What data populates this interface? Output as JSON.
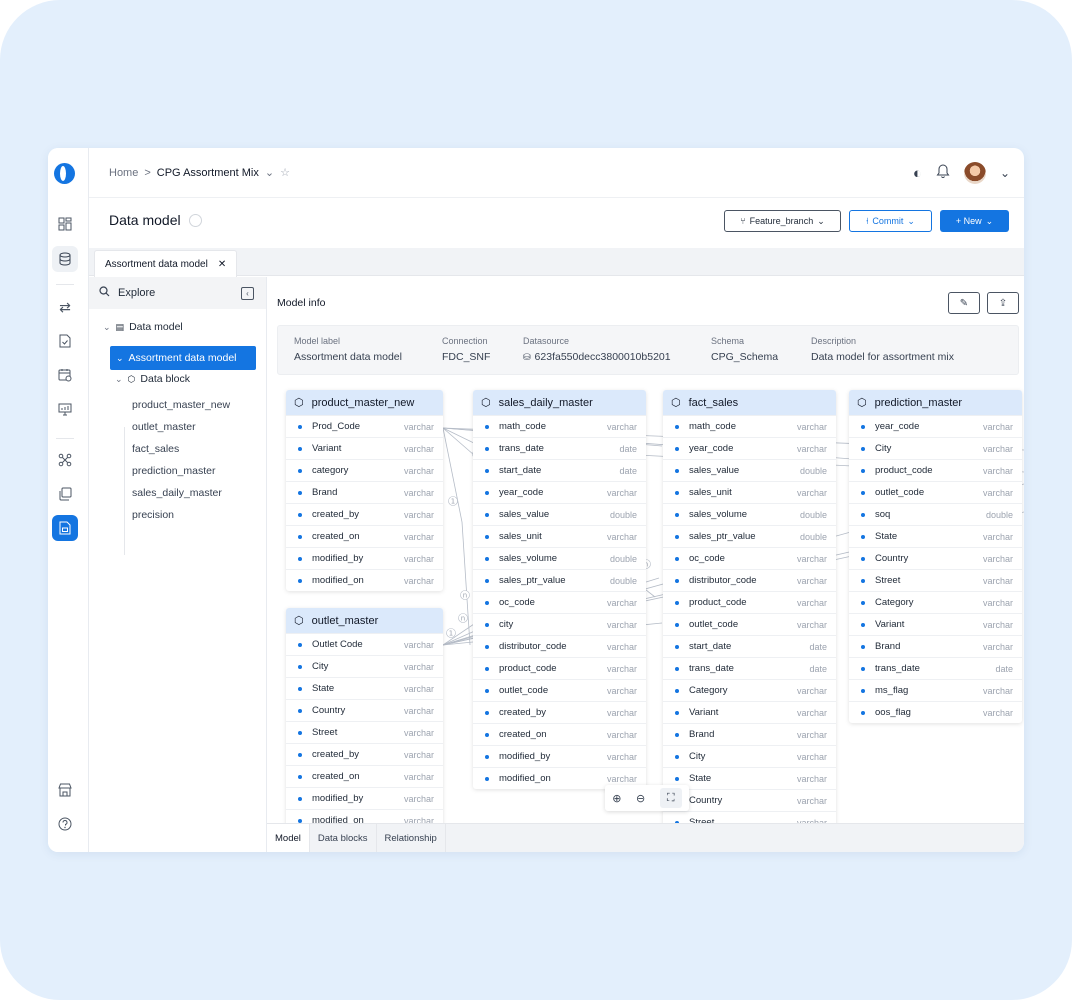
{
  "breadcrumb": {
    "home": "Home",
    "sep": ">",
    "current": "CPG Assortment Mix"
  },
  "page": {
    "title": "Data model"
  },
  "buttons": {
    "feature_branch": "Feature_branch",
    "commit": "Commit",
    "new": "+ New"
  },
  "doc_tab": {
    "label": "Assortment data model",
    "close": "✕"
  },
  "explore": {
    "title": "Explore",
    "tree": {
      "root": "Data model",
      "selected": "Assortment data model",
      "group": "Data block",
      "leaves": [
        "product_master_new",
        "outlet_master",
        "fact_sales",
        "prediction_master",
        "sales_daily_master",
        "precision"
      ]
    }
  },
  "model_info": {
    "title": "Model info",
    "fields": [
      {
        "key": "Model label",
        "value": "Assortment data model"
      },
      {
        "key": "Connection",
        "value": "FDC_SNF"
      },
      {
        "key": "Datasource",
        "value": "623fa550decc3800010b5201"
      },
      {
        "key": "Schema",
        "value": "CPG_Schema"
      },
      {
        "key": "Description",
        "value": "Data model for assortment mix"
      }
    ]
  },
  "tables": {
    "product_master_new": {
      "name": "product_master_new",
      "rows": [
        {
          "n": "Prod_Code",
          "t": "varchar"
        },
        {
          "n": "Variant",
          "t": "varchar"
        },
        {
          "n": "category",
          "t": "varchar"
        },
        {
          "n": "Brand",
          "t": "varchar"
        },
        {
          "n": "created_by",
          "t": "varchar"
        },
        {
          "n": "created_on",
          "t": "varchar"
        },
        {
          "n": "modified_by",
          "t": "varchar"
        },
        {
          "n": "modified_on",
          "t": "varchar"
        }
      ]
    },
    "outlet_master": {
      "name": "outlet_master",
      "rows": [
        {
          "n": "Outlet Code",
          "t": "varchar"
        },
        {
          "n": "City",
          "t": "varchar"
        },
        {
          "n": "State",
          "t": "varchar"
        },
        {
          "n": "Country",
          "t": "varchar"
        },
        {
          "n": "Street",
          "t": "varchar"
        },
        {
          "n": "created_by",
          "t": "varchar"
        },
        {
          "n": "created_on",
          "t": "varchar"
        },
        {
          "n": "modified_by",
          "t": "varchar"
        },
        {
          "n": "modified_on",
          "t": "varchar"
        }
      ]
    },
    "sales_daily_master": {
      "name": "sales_daily_master",
      "rows": [
        {
          "n": "math_code",
          "t": "varchar"
        },
        {
          "n": "trans_date",
          "t": "date"
        },
        {
          "n": "start_date",
          "t": "date"
        },
        {
          "n": "year_code",
          "t": "varchar"
        },
        {
          "n": "sales_value",
          "t": "double"
        },
        {
          "n": "sales_unit",
          "t": "varchar"
        },
        {
          "n": "sales_volume",
          "t": "double"
        },
        {
          "n": "sales_ptr_value",
          "t": "double"
        },
        {
          "n": "oc_code",
          "t": "varchar"
        },
        {
          "n": "city",
          "t": "varchar"
        },
        {
          "n": "distributor_code",
          "t": "varchar"
        },
        {
          "n": "product_code",
          "t": "varchar"
        },
        {
          "n": "outlet_code",
          "t": "varchar"
        },
        {
          "n": "created_by",
          "t": "varchar"
        },
        {
          "n": "created_on",
          "t": "varchar"
        },
        {
          "n": "modified_by",
          "t": "varchar"
        },
        {
          "n": "modified_on",
          "t": "varchar"
        }
      ]
    },
    "fact_sales": {
      "name": "fact_sales",
      "rows": [
        {
          "n": "math_code",
          "t": "varchar"
        },
        {
          "n": "year_code",
          "t": "varchar"
        },
        {
          "n": "sales_value",
          "t": "double"
        },
        {
          "n": "sales_unit",
          "t": "varchar"
        },
        {
          "n": "sales_volume",
          "t": "double"
        },
        {
          "n": "sales_ptr_value",
          "t": "double"
        },
        {
          "n": "oc_code",
          "t": "varchar"
        },
        {
          "n": "distributor_code",
          "t": "varchar"
        },
        {
          "n": "product_code",
          "t": "varchar"
        },
        {
          "n": "outlet_code",
          "t": "varchar"
        },
        {
          "n": "start_date",
          "t": "date"
        },
        {
          "n": "trans_date",
          "t": "date"
        },
        {
          "n": "Category",
          "t": "varchar"
        },
        {
          "n": "Variant",
          "t": "varchar"
        },
        {
          "n": "Brand",
          "t": "varchar"
        },
        {
          "n": "City",
          "t": "varchar"
        },
        {
          "n": "State",
          "t": "varchar"
        },
        {
          "n": "Country",
          "t": "varchar"
        },
        {
          "n": "Street",
          "t": "varchar"
        }
      ]
    },
    "prediction_master": {
      "name": "prediction_master",
      "rows": [
        {
          "n": "year_code",
          "t": "varchar"
        },
        {
          "n": "City",
          "t": "varchar"
        },
        {
          "n": "product_code",
          "t": "varchar"
        },
        {
          "n": "outlet_code",
          "t": "varchar"
        },
        {
          "n": "soq",
          "t": "double"
        },
        {
          "n": "State",
          "t": "varchar"
        },
        {
          "n": "Country",
          "t": "varchar"
        },
        {
          "n": "Street",
          "t": "varchar"
        },
        {
          "n": "Category",
          "t": "varchar"
        },
        {
          "n": "Variant",
          "t": "varchar"
        },
        {
          "n": "Brand",
          "t": "varchar"
        },
        {
          "n": "trans_date",
          "t": "date"
        },
        {
          "n": "ms_flag",
          "t": "varchar"
        },
        {
          "n": "oos_flag",
          "t": "varchar"
        }
      ]
    }
  },
  "bottom_tabs": [
    "Model",
    "Data blocks",
    "Relationship"
  ],
  "colors": {
    "accent": "#1475e1",
    "table_header": "#dbe9fb",
    "background": "#e3effc"
  }
}
